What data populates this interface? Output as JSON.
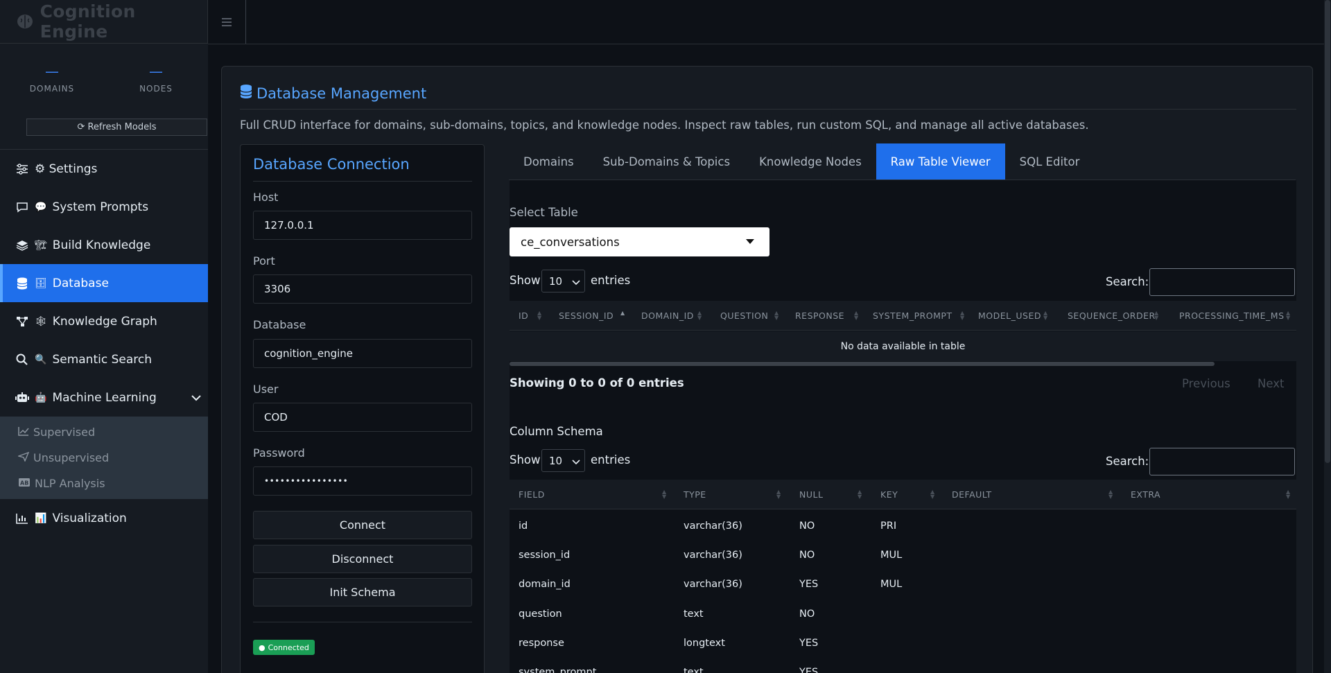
{
  "app": {
    "brand": "Cognition Engine"
  },
  "stats": [
    {
      "value": "—",
      "label": "DOMAINS"
    },
    {
      "value": "—",
      "label": "NODES"
    }
  ],
  "sidebar": {
    "refresh_label": "Refresh Models",
    "items": [
      {
        "emoji": "",
        "label": "⚙ Settings"
      },
      {
        "emoji": "💬",
        "label": "System Prompts"
      },
      {
        "emoji": "🏗",
        "label": "Build Knowledge"
      },
      {
        "emoji": "🗄",
        "label": "Database"
      },
      {
        "emoji": "🕸",
        "label": "Knowledge Graph"
      },
      {
        "emoji": "🔍",
        "label": "Semantic Search"
      },
      {
        "emoji": "🤖",
        "label": "Machine Learning"
      },
      {
        "emoji": "📊",
        "label": "Visualization"
      }
    ],
    "sub_items": [
      {
        "label": "Supervised"
      },
      {
        "label": "Unsupervised"
      },
      {
        "label": "NLP Analysis"
      }
    ]
  },
  "page": {
    "title": "Database Management",
    "description": "Full CRUD interface for domains, sub-domains, topics, and knowledge nodes. Inspect raw tables, run custom SQL, and manage all active databases."
  },
  "connection": {
    "title": "Database Connection",
    "host_label": "Host",
    "host_value": "127.0.0.1",
    "port_label": "Port",
    "port_value": "3306",
    "database_label": "Database",
    "database_value": "cognition_engine",
    "user_label": "User",
    "user_value": "COD",
    "password_label": "Password",
    "password_value": "••••••••••••••••",
    "connect_label": "Connect",
    "disconnect_label": "Disconnect",
    "init_label": "Init Schema",
    "status": "Connected",
    "status_color": "#1a9e55"
  },
  "tabs": [
    {
      "label": "Domains"
    },
    {
      "label": "Sub-Domains & Topics"
    },
    {
      "label": "Knowledge Nodes"
    },
    {
      "label": "Raw Table Viewer"
    },
    {
      "label": "SQL Editor"
    }
  ],
  "raw": {
    "select_label": "Select Table",
    "selected_table": "ce_conversations",
    "show_label": "Show",
    "entries_label": "entries",
    "page_length": "10",
    "search_label": "Search:",
    "columns": [
      "ID",
      "SESSION_ID",
      "DOMAIN_ID",
      "QUESTION",
      "RESPONSE",
      "SYSTEM_PROMPT",
      "MODEL_USED",
      "SEQUENCE_ORDER",
      "PROCESSING_TIME_MS"
    ],
    "empty_text": "No data available in table",
    "info": "Showing 0 to 0 of 0 entries",
    "prev_label": "Previous",
    "next_label": "Next"
  },
  "schema": {
    "title": "Column Schema",
    "show_label": "Show",
    "entries_label": "entries",
    "page_length": "10",
    "search_label": "Search:",
    "columns": [
      "FIELD",
      "TYPE",
      "NULL",
      "KEY",
      "DEFAULT",
      "EXTRA"
    ],
    "rows": [
      [
        "id",
        "varchar(36)",
        "NO",
        "PRI",
        "",
        ""
      ],
      [
        "session_id",
        "varchar(36)",
        "NO",
        "MUL",
        "",
        ""
      ],
      [
        "domain_id",
        "varchar(36)",
        "YES",
        "MUL",
        "",
        ""
      ],
      [
        "question",
        "text",
        "NO",
        "",
        "",
        ""
      ],
      [
        "response",
        "longtext",
        "YES",
        "",
        "",
        ""
      ],
      [
        "system_prompt",
        "text",
        "YES",
        "",
        "",
        ""
      ]
    ]
  },
  "colors": {
    "accent": "#1f6feb",
    "link": "#58a6ff",
    "success": "#1a9e55"
  }
}
